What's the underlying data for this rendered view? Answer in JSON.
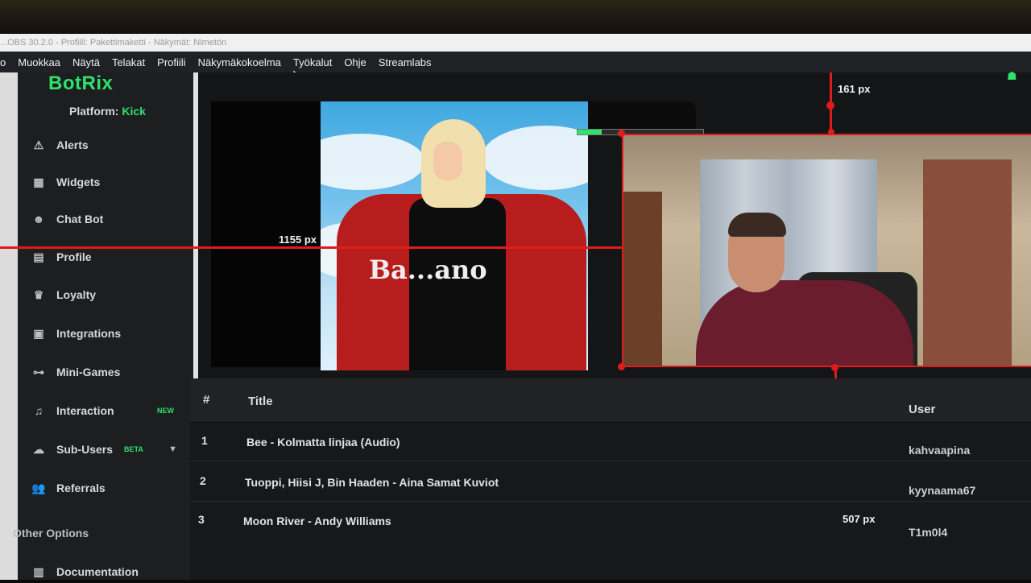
{
  "window": {
    "title": "...OBS 30.2.0 - Profiili: Pakettimaketti - Näkymät: Nimetön"
  },
  "menu": [
    "o",
    "Muokkaa",
    "Näytä",
    "Telakat",
    "Profiili",
    "Näkymäkokoelma",
    "Työkalut",
    "Ohje",
    "Streamlabs"
  ],
  "sidebar": {
    "logo": "BotRix",
    "platform_label": "Platform:",
    "platform_value": "Kick",
    "items": [
      {
        "label": "Alerts",
        "icon": "warning-icon"
      },
      {
        "label": "Widgets",
        "icon": "widgets-icon"
      },
      {
        "label": "Chat Bot",
        "icon": "robot-icon"
      },
      {
        "label": "Profile",
        "icon": "profile-card-icon"
      },
      {
        "label": "Loyalty",
        "icon": "trophy-icon"
      },
      {
        "label": "Integrations",
        "icon": "integrations-icon"
      },
      {
        "label": "Mini-Games",
        "icon": "gamepad-icon"
      },
      {
        "label": "Interaction",
        "icon": "music-note-icon",
        "badge": "NEW"
      },
      {
        "label": "Sub-Users",
        "icon": "users-cloud-icon",
        "badge": "BETA"
      },
      {
        "label": "Referrals",
        "icon": "referrals-icon"
      }
    ],
    "other_options_label": "Other Options",
    "documentation_label": "Documentation"
  },
  "measurements": {
    "top": "161 px",
    "left": "1155 px",
    "bottom": "507 px"
  },
  "table": {
    "headers": {
      "num": "#",
      "title": "Title",
      "user": "User"
    },
    "rows": [
      {
        "num": "1",
        "title": "Bee - Kolmatta linjaa (Audio)",
        "user": "kahvaapina"
      },
      {
        "num": "2",
        "title": "Tuoppi, Hiisi J, Bin Haaden - Aina Samat Kuviot",
        "user": "kyynaama67"
      },
      {
        "num": "3",
        "title": "Moon River - Andy Williams",
        "user": "T1m0l4"
      }
    ]
  },
  "preview": {
    "jacket_text": "Ba...ano"
  },
  "colors": {
    "accent": "#2ee26a",
    "guide": "#e01b1b",
    "background": "#141516"
  }
}
